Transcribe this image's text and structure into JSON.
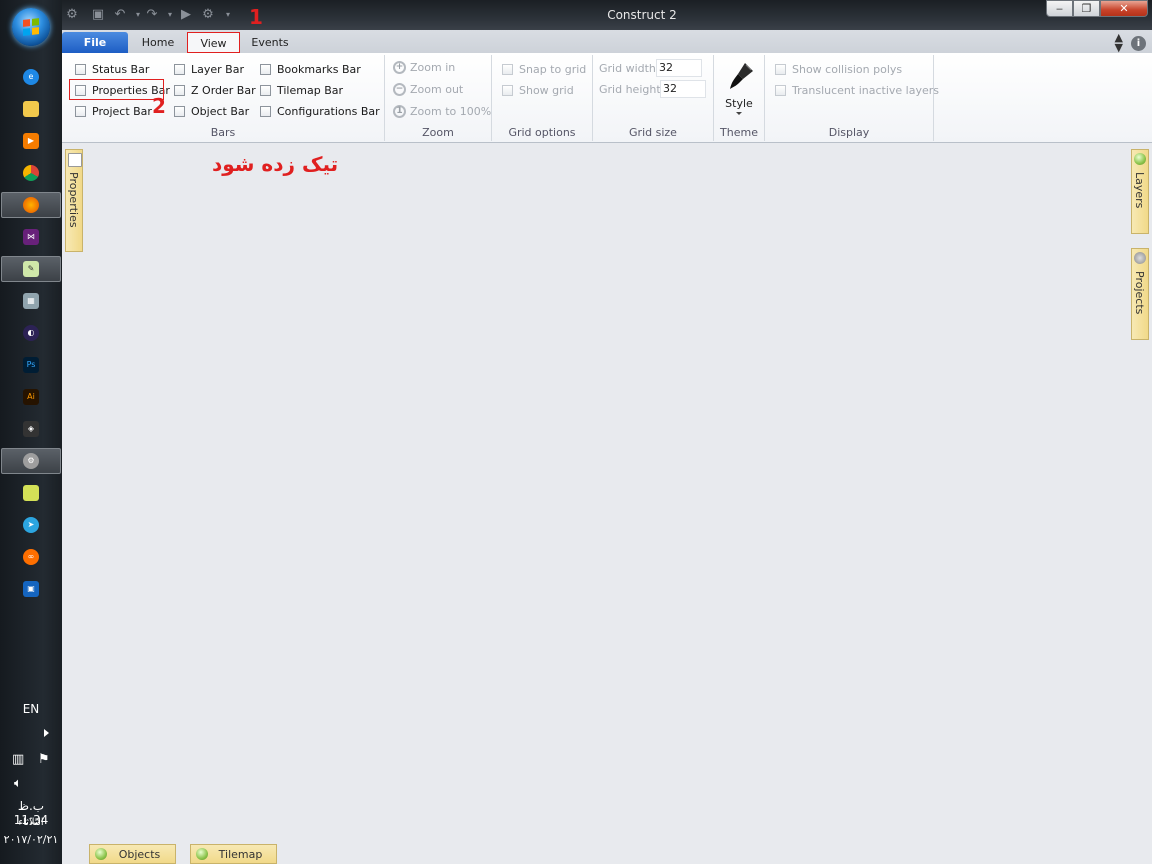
{
  "window": {
    "title": "Construct 2",
    "controls": {
      "minimize": "‒",
      "maximize": "❐",
      "close": "✕"
    }
  },
  "ribbon_tabs": [
    {
      "label": "File"
    },
    {
      "label": "Home"
    },
    {
      "label": "View"
    },
    {
      "label": "Events"
    }
  ],
  "bars_group": {
    "label": "Bars",
    "items": [
      {
        "label": "Status Bar",
        "checked": false
      },
      {
        "label": "Properties Bar",
        "checked": false
      },
      {
        "label": "Project Bar",
        "checked": false
      },
      {
        "label": "Layer Bar",
        "checked": false
      },
      {
        "label": "Z Order Bar",
        "checked": false
      },
      {
        "label": "Object Bar",
        "checked": false
      },
      {
        "label": "Bookmarks Bar",
        "checked": false
      },
      {
        "label": "Tilemap Bar",
        "checked": false
      },
      {
        "label": "Configurations Bar",
        "checked": false
      }
    ]
  },
  "zoom_group": {
    "label": "Zoom",
    "zoom_in": "Zoom in",
    "zoom_out": "Zoom out",
    "zoom_100": "Zoom to 100%"
  },
  "grid_options_group": {
    "label": "Grid options",
    "snap": "Snap to grid",
    "show": "Show grid"
  },
  "grid_size_group": {
    "label": "Grid size",
    "width_label": "Grid width",
    "width_value": "32",
    "height_label": "Grid height",
    "height_value": "32"
  },
  "theme_group": {
    "label": "Theme",
    "style_label": "Style"
  },
  "display_group": {
    "label": "Display",
    "collision": "Show collision polys",
    "translucent": "Translucent inactive layers"
  },
  "side_panels": {
    "left": "Properties",
    "right_1": "Layers",
    "right_2": "Projects"
  },
  "bottom_tabs": [
    {
      "label": "Objects"
    },
    {
      "label": "Tilemap"
    }
  ],
  "annotations": {
    "step_1": "1",
    "step_2": "2",
    "instruction": "تیک زده شود",
    "color": "#e02020"
  },
  "taskbar": {
    "language": "EN",
    "time": "ب.ظ 11:34",
    "day": "الثلاثاء",
    "date": "٢٠١٧/٠٢/٢١"
  }
}
